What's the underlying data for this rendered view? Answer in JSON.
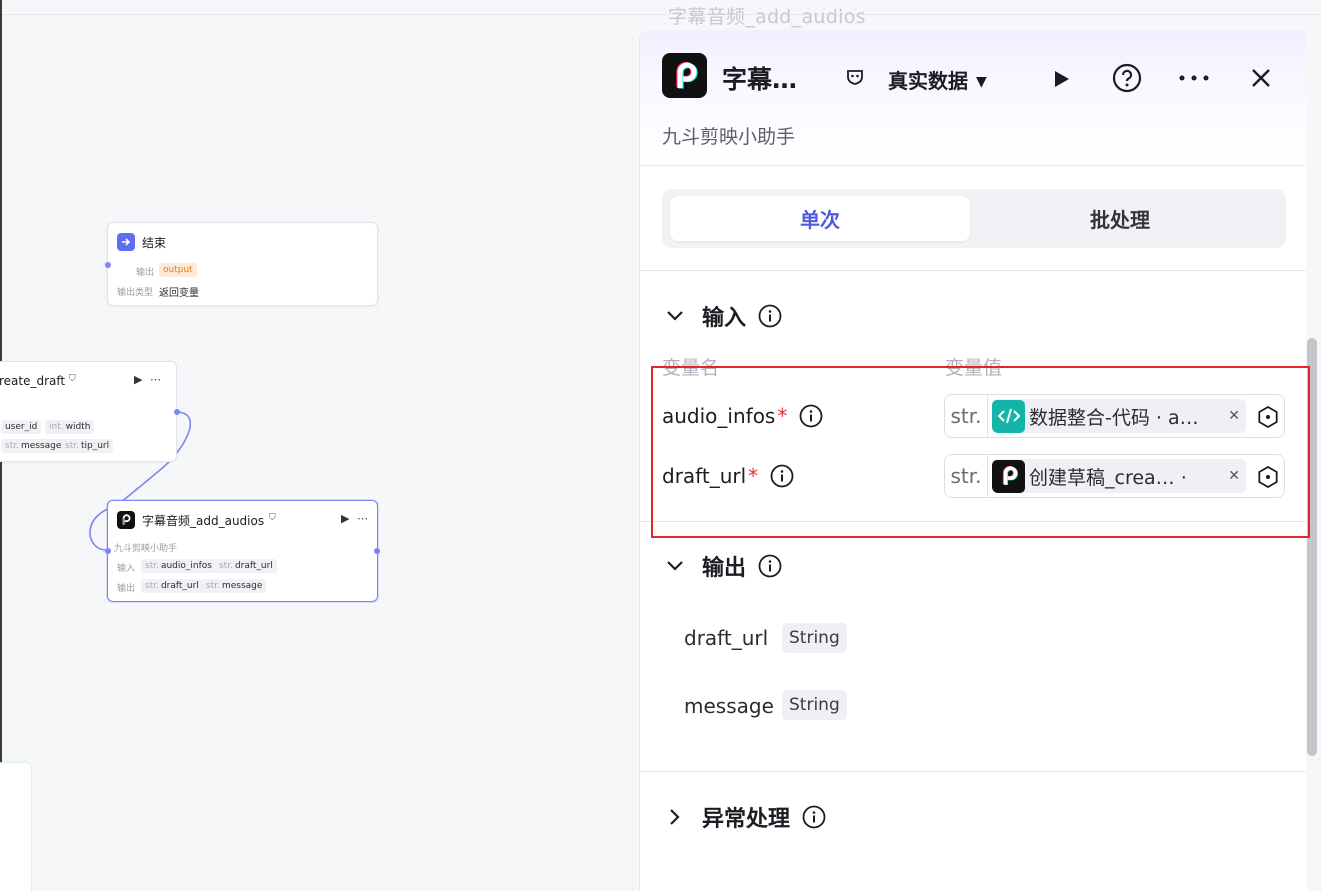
{
  "canvas": {
    "ghost_title": "字幕音频_add_audios",
    "end_node": {
      "title": "结束",
      "output_label": "输出",
      "output_value": "output",
      "output_type_label": "输出类型",
      "output_type_value": "返回变量"
    },
    "create_node": {
      "title": "reate_draft",
      "chips": [
        "user_id",
        "width",
        "message",
        "tip_url"
      ],
      "chip_types": [
        "",
        "int.",
        "str.",
        "str."
      ]
    },
    "audio_node": {
      "title": "字幕音频_add_audios",
      "subtitle": "九斗剪映小助手",
      "input_label": "输入",
      "output_label": "输出",
      "input_chips": [
        "audio_infos",
        "draft_url"
      ],
      "output_chips": [
        "draft_url",
        "message"
      ],
      "type_prefix": "str."
    }
  },
  "panel": {
    "title": "字幕…",
    "data_mode": "真实数据",
    "subtitle": "九斗剪映小助手",
    "tabs": [
      "单次",
      "批处理"
    ],
    "input_section": {
      "title": "输入",
      "col_name": "变量名",
      "col_value": "变量值",
      "params": [
        {
          "name": "audio_infos",
          "required": "*",
          "type": "str.",
          "ref": "数据整合-代码 · a…"
        },
        {
          "name": "draft_url",
          "required": "*",
          "type": "str.",
          "ref": "创建草稿_crea… ·"
        }
      ]
    },
    "output_section": {
      "title": "输出",
      "items": [
        {
          "name": "draft_url",
          "type": "String"
        },
        {
          "name": "message",
          "type": "String"
        }
      ]
    },
    "error_section": {
      "title": "异常处理"
    }
  },
  "colors": {
    "accent": "#4f5bdf",
    "required": "#e5302f",
    "highlight": "#e4262a",
    "code_icon": "#14b5a8"
  }
}
